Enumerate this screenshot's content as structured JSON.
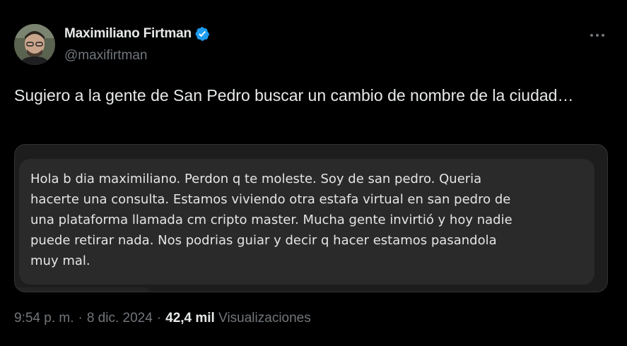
{
  "author": {
    "display_name": "Maximiliano Firtman",
    "handle": "@maxifirtman",
    "verified_icon": "verified-badge-icon",
    "avatar": "profile-photo"
  },
  "more_icon": "more-horizontal-icon",
  "tweet": {
    "text": "Sugiero a la gente de San Pedro buscar un cambio de nombre de la ciudad…"
  },
  "media": {
    "message_text": "Hola b dia maximiliano. Perdon q te moleste. Soy de san pedro. Queria\nhacerte una consulta. Estamos viviendo otra estafa virtual en san pedro de\nuna plataforma llamada cm cripto master. Mucha gente invirtió y hoy nadie\npuede retirar nada. Nos podrias guiar y decir q hacer estamos pasandola\nmuy mal."
  },
  "meta": {
    "time": "9:54 p. m.",
    "separator": "·",
    "date": "8 dic. 2024",
    "views_count": "42,4 mil",
    "views_label": "Visualizaciones"
  },
  "colors": {
    "background": "#000000",
    "text_primary": "#e7e9ea",
    "text_secondary": "#71767b",
    "verified_blue": "#1d9bf0",
    "bubble": "#2a2a2a"
  }
}
